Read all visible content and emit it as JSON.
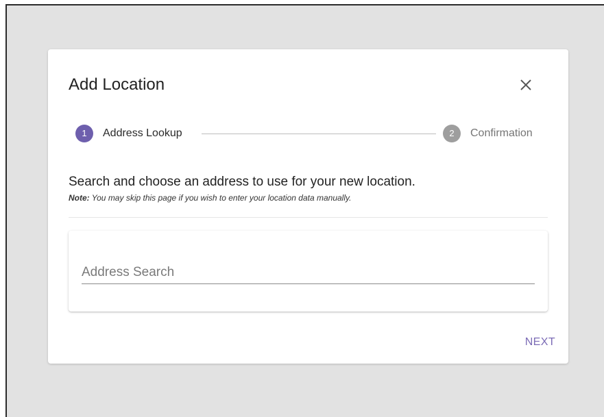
{
  "dialog": {
    "title": "Add Location",
    "close_icon": "close-icon"
  },
  "stepper": {
    "steps": [
      {
        "number": "1",
        "label": "Address Lookup",
        "state": "active"
      },
      {
        "number": "2",
        "label": "Confirmation",
        "state": "inactive"
      }
    ]
  },
  "content": {
    "instructions": "Search and choose an address to use for your new location.",
    "note_label": "Note:",
    "note_text": " You may skip this page if you wish to enter your location data manually."
  },
  "search": {
    "value": "",
    "placeholder": "Address Search"
  },
  "actions": {
    "next_label": "NEXT"
  },
  "colors": {
    "accent": "#6e5fad",
    "inactive_step": "#9e9e9e",
    "backdrop": "#e2e2e2"
  }
}
